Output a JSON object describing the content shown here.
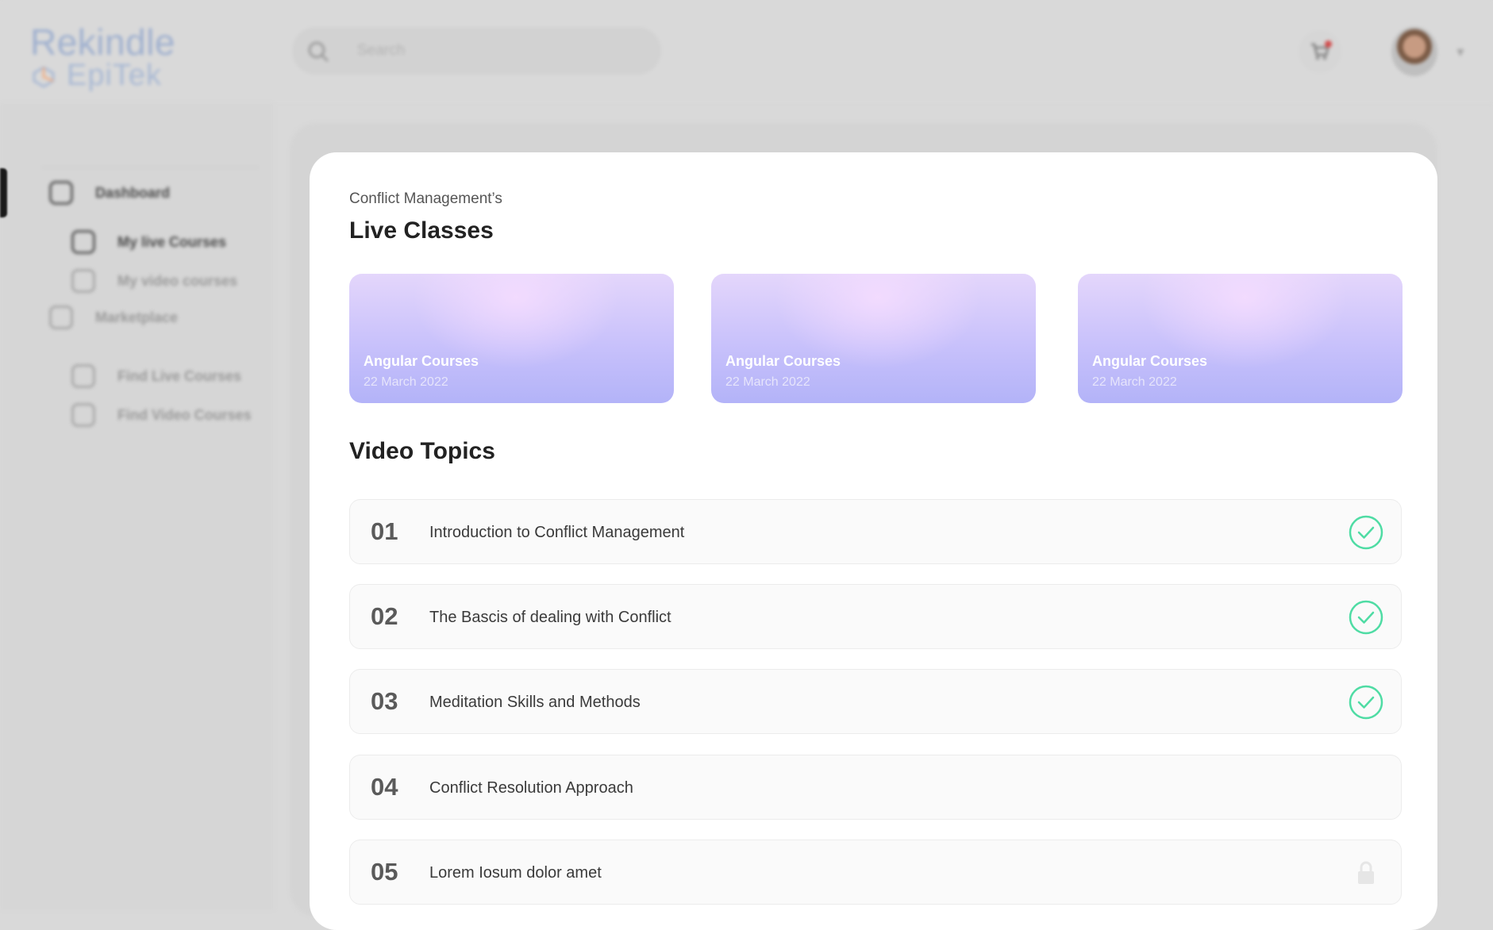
{
  "brand": {
    "line1": "Rekindle",
    "line2": "EpiTek"
  },
  "search": {
    "placeholder": "Search"
  },
  "sidebar": {
    "items": [
      {
        "label": "Dashboard",
        "icon": "dashboard-icon"
      },
      {
        "label": "My live Courses",
        "icon": "live-icon"
      },
      {
        "label": "My video courses",
        "icon": "play-icon"
      },
      {
        "label": "Marketplace",
        "icon": "market-icon"
      },
      {
        "label": "Find Live Courses",
        "icon": "live-icon"
      },
      {
        "label": "Find Video Courses",
        "icon": "play-icon"
      }
    ]
  },
  "main": {
    "subtitle": "Conflict Management’s",
    "title": "Live Classes",
    "live_classes": [
      {
        "title": "Angular Courses",
        "date": "22 March 2022"
      },
      {
        "title": "Angular Courses",
        "date": "22 March 2022"
      },
      {
        "title": "Angular Courses",
        "date": "22 March 2022"
      }
    ],
    "video_section_title": "Video Topics",
    "topics": [
      {
        "num": "01",
        "title": "Introduction to Conflict Management",
        "status": "completed"
      },
      {
        "num": "02",
        "title": "The Bascis  of dealing with Conflict",
        "status": "completed"
      },
      {
        "num": "03",
        "title": "Meditation Skills and Methods",
        "status": "completed"
      },
      {
        "num": "04",
        "title": "Conflict Resolution Approach",
        "status": "none"
      },
      {
        "num": "05",
        "title": "Lorem Iosum dolor amet",
        "status": "locked"
      }
    ]
  },
  "colors": {
    "check": "#4fdca4",
    "card_gradient_start": "#e4d6fb",
    "card_gradient_end": "#b3b3f8"
  }
}
